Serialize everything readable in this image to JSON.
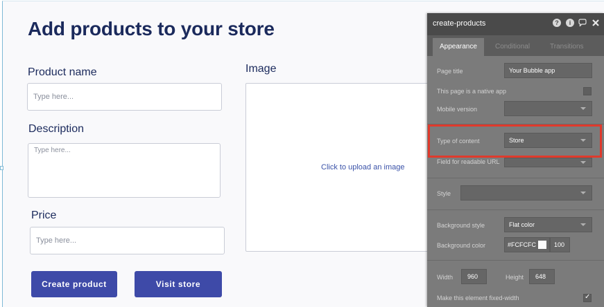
{
  "canvas": {
    "title": "Add products to your store",
    "product_name_label": "Product name",
    "product_name_placeholder": "Type here...",
    "description_label": "Description",
    "description_placeholder": "Type here...",
    "price_label": "Price",
    "price_placeholder": "Type here...",
    "image_label": "Image",
    "upload_text": "Click to upload an image",
    "create_button": "Create product",
    "visit_button": "Visit store"
  },
  "panel": {
    "title": "create-products",
    "icons": [
      "help-icon",
      "info-icon",
      "chat-icon",
      "close-icon"
    ],
    "help_glyph": "?",
    "info_glyph": "i",
    "tabs": [
      "Appearance",
      "Conditional",
      "Transitions"
    ],
    "active_tab": "Appearance",
    "page_title_label": "Page title",
    "page_title_value": "Your Bubble app",
    "native_app_label": "This page is a native app",
    "mobile_version_label": "Mobile version",
    "mobile_version_value": "",
    "type_of_content_label": "Type of content",
    "type_of_content_value": "Store",
    "readable_url_label": "Field for readable URL",
    "style_label": "Style",
    "bg_style_label": "Background style",
    "bg_style_value": "Flat color",
    "bg_color_label": "Background color",
    "bg_color_value": "#FCFCFC",
    "bg_opacity": "100",
    "width_label": "Width",
    "width_value": "960",
    "height_label": "Height",
    "height_value": "648",
    "fixed_width_label": "Make this element fixed-width",
    "fixed_width_checked": true
  },
  "colors": {
    "heading": "#1b2a5c",
    "button": "#3e4aa8",
    "panel_bg": "#7b7b7b",
    "panel_header": "#4a4a4a",
    "highlight": "#e03a2c"
  }
}
